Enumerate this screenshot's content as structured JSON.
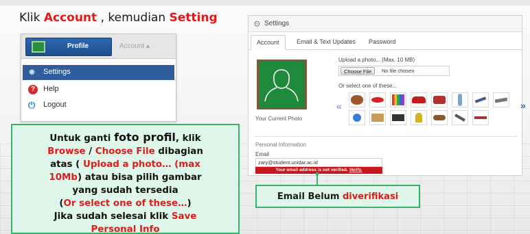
{
  "heading": {
    "part1": "Klik ",
    "account": "Account",
    "part2": " , kemudian ",
    "setting": "Setting"
  },
  "account_menu": {
    "profile_label": "Profile",
    "account_tab": "Account ▴",
    "items": [
      {
        "label": "Settings",
        "icon": "gear-icon"
      },
      {
        "label": "Help",
        "icon": "help-icon"
      },
      {
        "label": "Logout",
        "icon": "logout-icon"
      }
    ]
  },
  "settings": {
    "title": "Settings",
    "tabs": [
      "Account",
      "Email & Text Updates",
      "Password"
    ],
    "active_tab": "Account",
    "current_photo_caption": "Your Current Photo",
    "upload_label": "Upload a photo... (Max. 10 MB)",
    "choose_file": "Choose File",
    "no_file": "No file chosen",
    "select_label": "Or select one of these...",
    "personal_info_label": "Personal Information",
    "email_label": "Email",
    "email_value": "zary@student.unidar.ac.id",
    "verify_msg": "Your email address is not verified. ",
    "verify_link": "Verify."
  },
  "callout_left": {
    "l1a": "Untuk ganti ",
    "l1b": "foto profil",
    "l1c": ", klik",
    "l2a": "Browse",
    "l2b": " / ",
    "l2c": "Choose File",
    "l2d": "  dibagian",
    "l3a": "atas ( ",
    "l3b": "Upload a photo… (max",
    "l4a": "10Mb",
    "l4b": ") atau bisa pilih gambar",
    "l5": "yang sudah tersedia",
    "l6a": "(",
    "l6b": "Or select one of these…",
    "l6c": ")",
    "l7a": "Jika sudah selesai klik ",
    "l7b": "Save",
    "l8": "Personal Info"
  },
  "callout_right": {
    "a": "Email Belum ",
    "b": "diverifikasi"
  },
  "colors": {
    "accent_red": "#e01b1b",
    "callout_bg": "#dff7ea",
    "callout_border": "#35b36b",
    "menu_active": "#2f5d9c"
  }
}
